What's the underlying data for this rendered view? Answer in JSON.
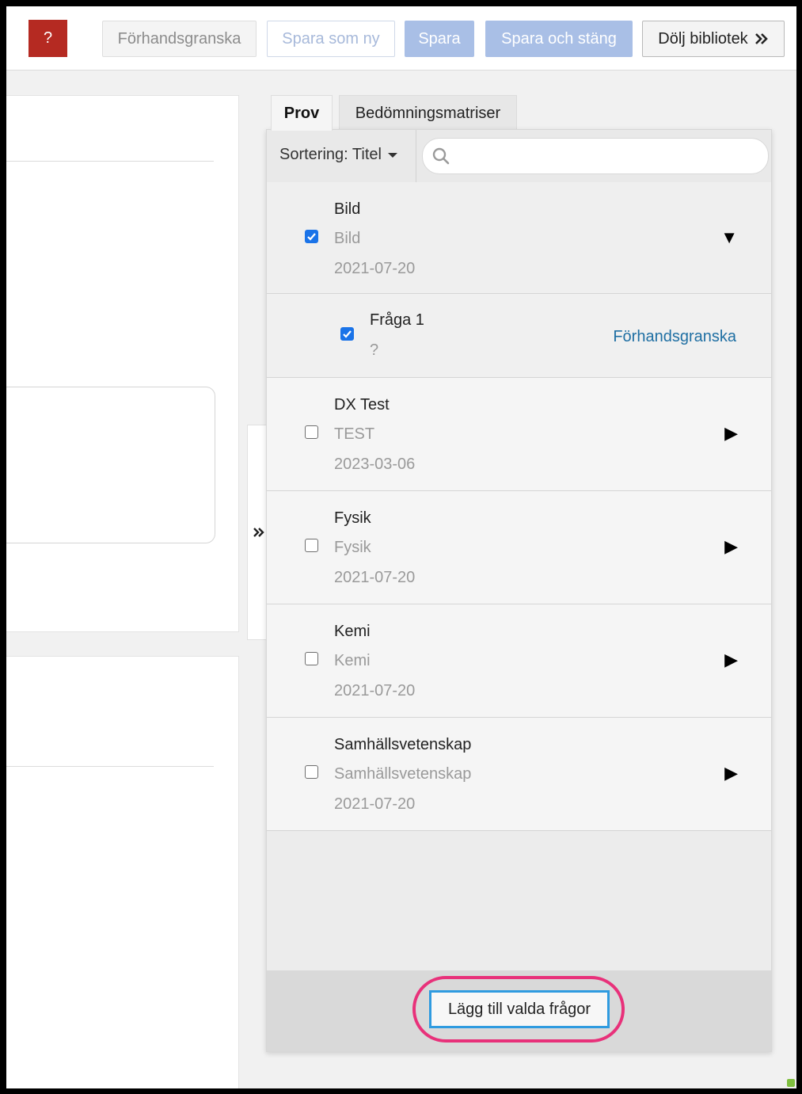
{
  "toolbar": {
    "help_label": "?",
    "preview_label": "Förhandsgranska",
    "save_as_new_label": "Spara som ny",
    "save_label": "Spara",
    "save_close_label": "Spara och stäng",
    "hide_library_label": "Dölj bibliotek"
  },
  "library": {
    "tabs": [
      {
        "label": "Prov",
        "active": true
      },
      {
        "label": "Bedömningsmatriser",
        "active": false
      }
    ],
    "sort_label": "Sortering: Titel",
    "search": {
      "placeholder": "",
      "value": ""
    },
    "exams": [
      {
        "title": "Bild",
        "subtitle": "Bild",
        "date": "2021-07-20",
        "checked": true,
        "expanded": true,
        "questions": [
          {
            "title": "Fråga 1",
            "subtitle": "?",
            "checked": true,
            "action": "Förhandsgranska"
          }
        ]
      },
      {
        "title": "DX Test",
        "subtitle": "TEST",
        "date": "2023-03-06",
        "checked": false,
        "expanded": false
      },
      {
        "title": "Fysik",
        "subtitle": "Fysik",
        "date": "2021-07-20",
        "checked": false,
        "expanded": false
      },
      {
        "title": "Kemi",
        "subtitle": "Kemi",
        "date": "2021-07-20",
        "checked": false,
        "expanded": false
      },
      {
        "title": "Samhällsvetenskap",
        "subtitle": "Samhällsvetenskap",
        "date": "2021-07-20",
        "checked": false,
        "expanded": false
      }
    ],
    "add_selected_label": "Lägg till valda frågor"
  },
  "icons": {
    "hide_library": "double-chevron-right-icon",
    "collapse": "double-chevron-right-icon",
    "search": "search-icon",
    "expanded": "triangle-down-icon",
    "collapsed": "triangle-right-icon"
  },
  "colors": {
    "help_button": "#b52a22",
    "primary_disabled": "#a9bfe6",
    "link": "#1f6fa3",
    "checkbox_checked": "#1a73e8",
    "highlight_ring": "#e8317a",
    "focus_border": "#2f9be0"
  }
}
